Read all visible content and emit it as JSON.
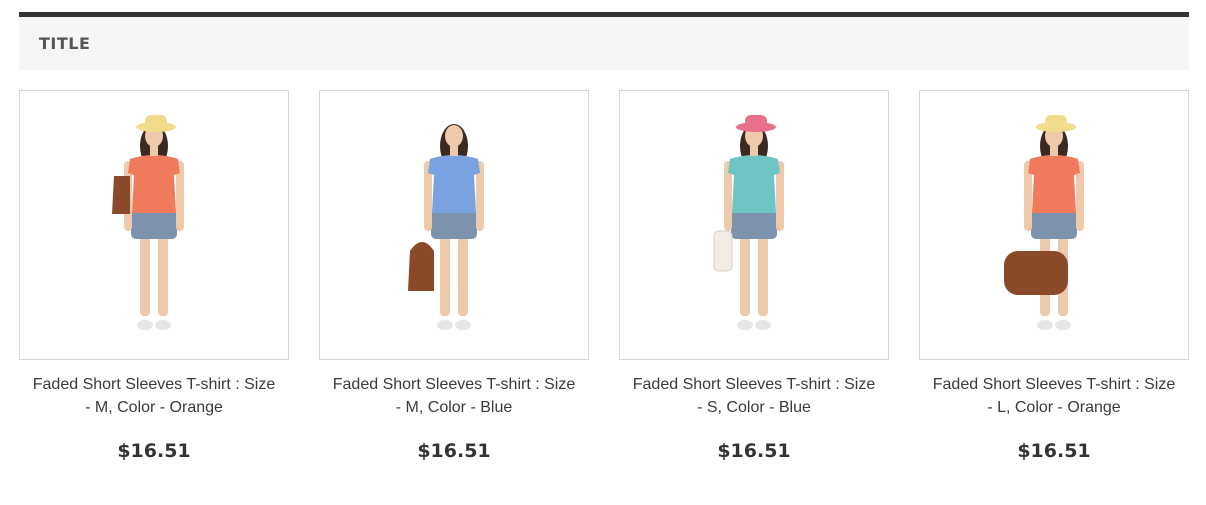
{
  "block": {
    "title": "TITLE"
  },
  "products": [
    {
      "name": "Faded Short Sleeves T-shirt : Size - M, Color - Orange",
      "price": "$16.51",
      "shirt_color": "#f07a5c",
      "hat_color": "#f0dc8a",
      "bag": "shoulder"
    },
    {
      "name": "Faded Short Sleeves T-shirt : Size - M, Color - Blue",
      "price": "$16.51",
      "shirt_color": "#7aa2e0",
      "hat_color": "",
      "bag": "hand-low"
    },
    {
      "name": "Faded Short Sleeves T-shirt : Size - S, Color - Blue",
      "price": "$16.51",
      "shirt_color": "#6fc4c4",
      "hat_color": "#e8708a",
      "bag": "white"
    },
    {
      "name": "Faded Short Sleeves T-shirt : Size - L, Color - Orange",
      "price": "$16.51",
      "shirt_color": "#f07a5c",
      "hat_color": "#f0dc8a",
      "bag": "duffel"
    }
  ]
}
